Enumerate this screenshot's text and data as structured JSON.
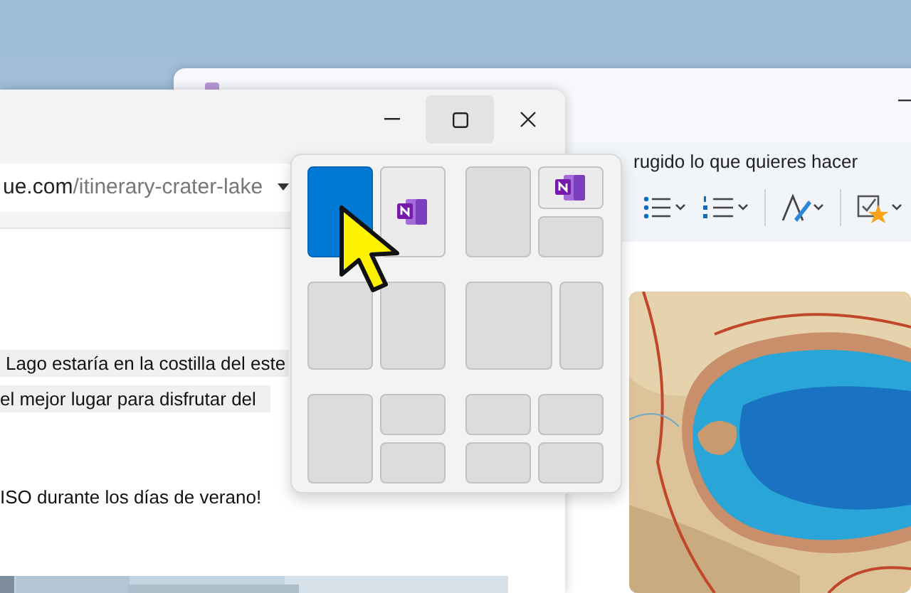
{
  "back_window": {
    "search_text": "rugido lo que quieres hacer"
  },
  "browser": {
    "address_domain": "ue.com",
    "address_path": "/itinerary-crater-lake",
    "paragraphs": [
      {
        "text": "Lago estaría en la costilla del este",
        "highlighted": true
      },
      {
        "text": "el mejor lugar para disfrutar del",
        "highlighted": true
      },
      {
        "text": "ISO durante los días de verano!",
        "highlighted": false
      }
    ]
  },
  "snap_layouts": [
    {
      "kind": "halves",
      "zones": [
        {
          "kind": "selected"
        },
        {
          "kind": "app"
        }
      ]
    },
    {
      "kind": "left-stack",
      "zones": [
        {
          "kind": "empty"
        },
        {
          "kind": "app"
        },
        {
          "kind": "empty"
        }
      ]
    },
    {
      "kind": "halves",
      "zones": [
        {
          "kind": "empty"
        },
        {
          "kind": "empty"
        }
      ]
    },
    {
      "kind": "wide-narrow",
      "zones": [
        {
          "kind": "empty"
        },
        {
          "kind": "empty"
        }
      ]
    },
    {
      "kind": "tall-stack",
      "zones": [
        {
          "kind": "empty"
        },
        {
          "kind": "empty"
        },
        {
          "kind": "empty"
        }
      ]
    },
    {
      "kind": "quad",
      "zones": [
        {
          "kind": "empty"
        },
        {
          "kind": "empty"
        },
        {
          "kind": "empty"
        },
        {
          "kind": "empty"
        }
      ]
    }
  ]
}
